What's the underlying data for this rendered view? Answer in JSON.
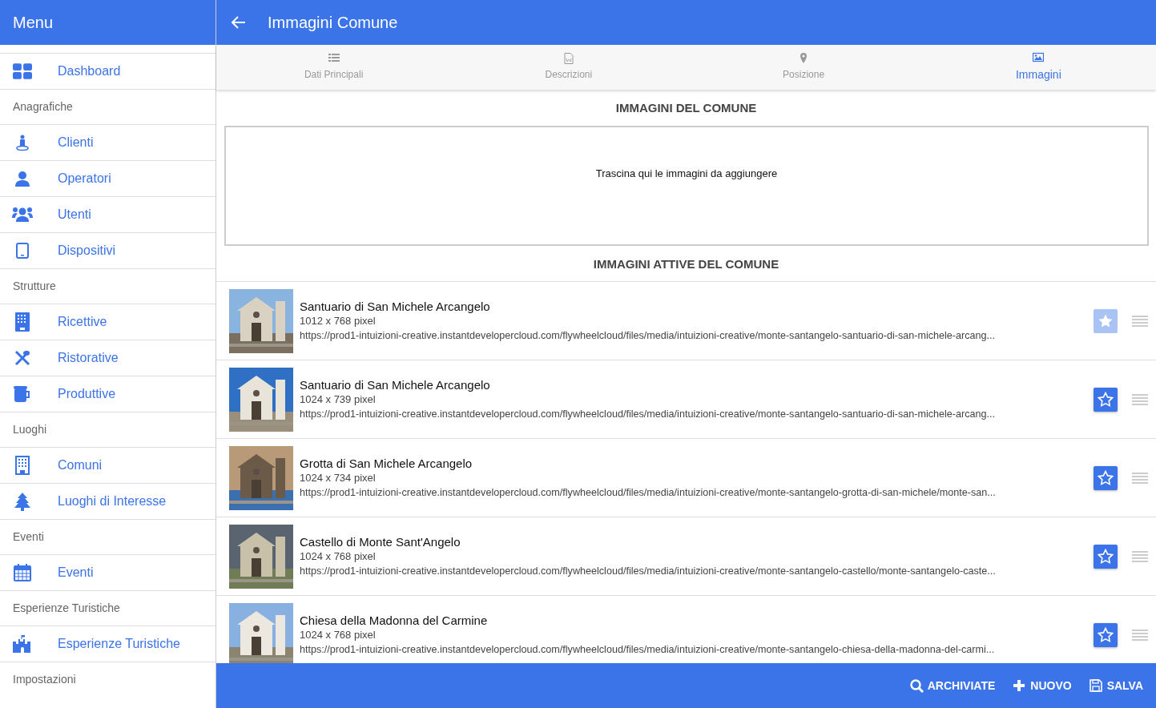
{
  "sidebar": {
    "title": "Menu",
    "items": [
      {
        "kind": "link",
        "label": "Dashboard"
      },
      {
        "kind": "header",
        "label": "Anagrafiche"
      },
      {
        "kind": "link",
        "label": "Clienti"
      },
      {
        "kind": "link",
        "label": "Operatori"
      },
      {
        "kind": "link",
        "label": "Utenti"
      },
      {
        "kind": "link",
        "label": "Dispositivi"
      },
      {
        "kind": "header",
        "label": "Strutture"
      },
      {
        "kind": "link",
        "label": "Ricettive"
      },
      {
        "kind": "link",
        "label": "Ristorative"
      },
      {
        "kind": "link",
        "label": "Produttive"
      },
      {
        "kind": "header",
        "label": "Luoghi"
      },
      {
        "kind": "link",
        "label": "Comuni"
      },
      {
        "kind": "link",
        "label": "Luoghi di Interesse"
      },
      {
        "kind": "header",
        "label": "Eventi"
      },
      {
        "kind": "link",
        "label": "Eventi"
      },
      {
        "kind": "header",
        "label": "Esperienze Turistiche"
      },
      {
        "kind": "link",
        "label": "Esperienze Turistiche"
      },
      {
        "kind": "header",
        "label": "Impostazioni"
      }
    ]
  },
  "header": {
    "title": "Immagini Comune"
  },
  "tabs": [
    {
      "label": "Dati Principali",
      "selected": false
    },
    {
      "label": "Descrizioni",
      "selected": false
    },
    {
      "label": "Posizione",
      "selected": false
    },
    {
      "label": "Immagini",
      "selected": true
    }
  ],
  "upload": {
    "title": "IMMAGINI DEL COMUNE",
    "hint": "Trascina qui le immagini da aggiungere"
  },
  "images": {
    "title": "IMMAGINI ATTIVE DEL COMUNE",
    "items": [
      {
        "name": "Santuario di San Michele Arcangelo",
        "size": "1012 x 768 pixel",
        "url": "https://prod1-intuizioni-creative.instantdevelopercloud.com/flywheelcloud/files/media/intuizioni-creative/monte-santangelo-santuario-di-san-michele-arcang...",
        "cover": true
      },
      {
        "name": "Santuario di San Michele Arcangelo",
        "size": "1024 x 739 pixel",
        "url": "https://prod1-intuizioni-creative.instantdevelopercloud.com/flywheelcloud/files/media/intuizioni-creative/monte-santangelo-santuario-di-san-michele-arcang...",
        "cover": false
      },
      {
        "name": "Grotta di San Michele Arcangelo",
        "size": "1024 x 734 pixel",
        "url": "https://prod1-intuizioni-creative.instantdevelopercloud.com/flywheelcloud/files/media/intuizioni-creative/monte-santangelo-grotta-di-san-michele/monte-san...",
        "cover": false
      },
      {
        "name": "Castello di Monte Sant'Angelo",
        "size": "1024 x 768 pixel",
        "url": "https://prod1-intuizioni-creative.instantdevelopercloud.com/flywheelcloud/files/media/intuizioni-creative/monte-santangelo-castello/monte-santangelo-caste...",
        "cover": false
      },
      {
        "name": "Chiesa della Madonna del Carmine",
        "size": "1024 x 768 pixel",
        "url": "https://prod1-intuizioni-creative.instantdevelopercloud.com/flywheelcloud/files/media/intuizioni-creative/monte-santangelo-chiesa-della-madonna-del-carmi...",
        "cover": false
      }
    ]
  },
  "footer": {
    "buttons": [
      "ARCHIVIATE",
      "NUOVO",
      "SALVA"
    ]
  }
}
